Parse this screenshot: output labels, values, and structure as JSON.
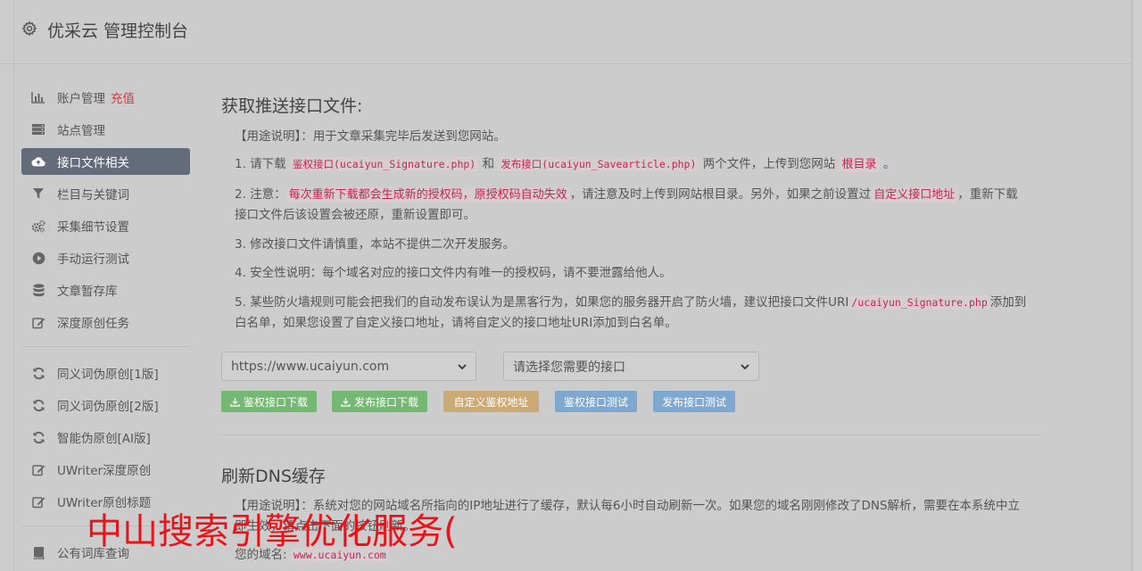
{
  "app": {
    "title": "优采云 管理控制台"
  },
  "sidebar": {
    "items": [
      {
        "label": "账户管理",
        "extra": "充值",
        "icon": "bar-chart-icon"
      },
      {
        "label": "站点管理",
        "icon": "server-icon"
      },
      {
        "label": "接口文件相关",
        "icon": "cloud-upload-icon",
        "active": true
      },
      {
        "label": "栏目与关键词",
        "icon": "filter-icon"
      },
      {
        "label": "采集细节设置",
        "icon": "gears-icon"
      },
      {
        "label": "手动运行测试",
        "icon": "play-circle-icon"
      },
      {
        "label": "文章暂存库",
        "icon": "database-icon"
      },
      {
        "label": "深度原创任务",
        "icon": "edit-icon"
      }
    ],
    "items2": [
      {
        "label": "同义词伪原创[1版]",
        "icon": "refresh-icon"
      },
      {
        "label": "同义词伪原创[2版]",
        "icon": "refresh-icon"
      },
      {
        "label": "智能伪原创[AI版]",
        "icon": "refresh-icon"
      },
      {
        "label": "UWriter深度原创",
        "icon": "edit-icon"
      },
      {
        "label": "UWriter原创标题",
        "icon": "edit-icon"
      }
    ],
    "items3": [
      {
        "label": "公有词库查询",
        "icon": "book-icon"
      }
    ]
  },
  "section1": {
    "title": "获取推送接口文件:",
    "usage": "【用途说明】：用于文章采集完毕后发送到您网站。",
    "p1": {
      "a": "1. 请下载",
      "code1": "鉴权接口(ucaiyun_Signature.php)",
      "b": "和",
      "code2": "发布接口(ucaiyun_Savearticle.php)",
      "c": "两个文件，上传到您网站",
      "code3": "根目录",
      "d": "。"
    },
    "p2": {
      "a": "2. 注意：",
      "code1": "每次重新下载都会生成新的授权码，原授权码自动失效",
      "b": "，请注意及时上传到网站根目录。另外，如果之前设置过",
      "code2": "自定义接口地址",
      "c": "，重新下载接口文件后该设置会被还原，重新设置即可。"
    },
    "p3": "3. 修改接口文件请慎重，本站不提供二次开发服务。",
    "p4": "4. 安全性说明：每个域名对应的接口文件内有唯一的授权码，请不要泄露给他人。",
    "p5": {
      "a": "5. 某些防火墙规则可能会把我们的自动发布误认为是黑客行为，如果您的服务器开启了防火墙，建议把接口文件URI",
      "code1": "/ucaiyun_Signature.php",
      "b": "添加到白名单，如果您设置了自定义接口地址，请将自定义的接口地址URI添加到白名单。"
    },
    "site_select": "https://www.ucaiyun.com",
    "api_select": "请选择您需要的接口",
    "buttons": {
      "dl_auth": "鉴权接口下载",
      "dl_pub": "发布接口下载",
      "custom": "自定义鉴权地址",
      "test_auth": "鉴权接口测试",
      "test_pub": "发布接口测试"
    }
  },
  "section2": {
    "title": "刷新DNS缓存",
    "usage": "【用途说明】：系统对您的网站域名所指向的IP地址进行了缓存，默认每6小时自动刷新一次。如果您的域名刚刚修改了DNS解析，需要在本系统中立即生效，请点击下面的按钮刷新。",
    "domain_label": "您的域名:",
    "domain_value": "www.ucaiyun.com"
  },
  "watermark": "中山搜索引擎优化服务(",
  "colors": {
    "active_nav": "#646c7a",
    "accent_red": "#d9363e",
    "code": "#c7254e",
    "green": "#74b874",
    "orange": "#ccaa76",
    "blue": "#7ea8cf"
  }
}
